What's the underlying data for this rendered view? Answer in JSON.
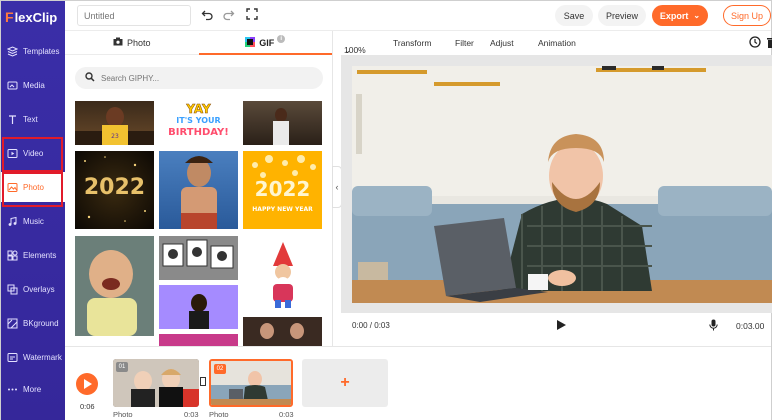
{
  "app": {
    "logo_text": "lexClip",
    "logo_letter": "F"
  },
  "sidebar": {
    "items": [
      {
        "label": "Templates",
        "icon": "templates-icon"
      },
      {
        "label": "Media",
        "icon": "media-icon"
      },
      {
        "label": "Text",
        "icon": "text-icon"
      },
      {
        "label": "Video",
        "icon": "video-icon"
      },
      {
        "label": "Photo",
        "icon": "photo-icon"
      },
      {
        "label": "Music",
        "icon": "music-icon"
      },
      {
        "label": "Elements",
        "icon": "elements-icon"
      },
      {
        "label": "Overlays",
        "icon": "overlays-icon"
      },
      {
        "label": "BKground",
        "icon": "background-icon"
      },
      {
        "label": "Watermark",
        "icon": "watermark-icon"
      },
      {
        "label": "More",
        "icon": "more-icon"
      }
    ],
    "active": "Photo"
  },
  "topbar": {
    "title_placeholder": "Untitled",
    "save_label": "Save",
    "preview_label": "Preview",
    "export_label": "Export",
    "signup_label": "Sign Up"
  },
  "panel": {
    "tabs": [
      {
        "label": "Photo"
      },
      {
        "label": "GIF"
      }
    ],
    "active_tab": "GIF",
    "search_placeholder": "Search GIPHY...",
    "gif_texts": {
      "yay1": "YAY",
      "yay2": "IT'S YOUR",
      "yay3": "BIRTHDAY!",
      "y2022a": "2022",
      "y2022b": "2022",
      "hny": "HAPPY NEW YEAR"
    }
  },
  "preview_toolbar": {
    "zoom": "100%",
    "transform": "Transform",
    "filter": "Filter",
    "adjust": "Adjust",
    "animation": "Animation"
  },
  "transport": {
    "current_time": "0:00 / 0:03",
    "duration": "0:03.00"
  },
  "timeline": {
    "time": "0:06",
    "clips": [
      {
        "num": "01",
        "label": "Photo",
        "duration": "0:03"
      },
      {
        "num": "02",
        "label": "Photo",
        "duration": "0:03"
      }
    ],
    "add_label": "+"
  },
  "colors": {
    "accent": "#ff6a2a",
    "sidebar": "#3a2ea8",
    "highlight": "#e11b2a"
  }
}
